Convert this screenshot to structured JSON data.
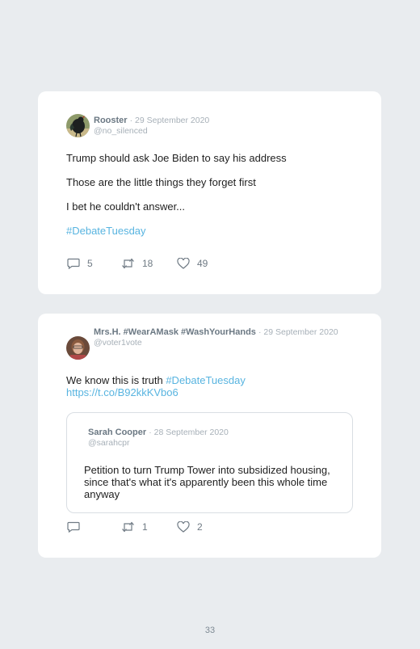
{
  "tweets": [
    {
      "author": "Rooster",
      "date": "· 29 September 2020",
      "handle": "@no_silenced",
      "lines": [
        "Trump should ask Joe Biden to say his address",
        "Those are the little things they forget first",
        "I bet he couldn't answer..."
      ],
      "hashtag": "#DebateTuesday",
      "replies": "5",
      "retweets": "18",
      "likes": "49"
    },
    {
      "author": "Mrs.H. #WearAMask #WashYourHands",
      "date": "· 29 September 2020",
      "handle": "@voter1vote",
      "text": "We know this is truth",
      "hashtag": "#DebateTuesday",
      "url": "https://t.co/B92kkKVbo6",
      "quoted": {
        "author": "Sarah Cooper",
        "date": "· 28 September 2020",
        "handle": "@sarahcpr",
        "text": "Petition to turn Trump Tower into subsidized housing, since that's what it's apparently been this whole time anyway"
      },
      "replies": "",
      "retweets": "1",
      "likes": "2"
    }
  ],
  "page_number": "33",
  "colors": {
    "background": "#e9ecef",
    "card": "#ffffff",
    "link": "#58b4e0",
    "meta": "#a7b0b8"
  },
  "icons": [
    "reply-icon",
    "retweet-icon",
    "like-icon"
  ]
}
